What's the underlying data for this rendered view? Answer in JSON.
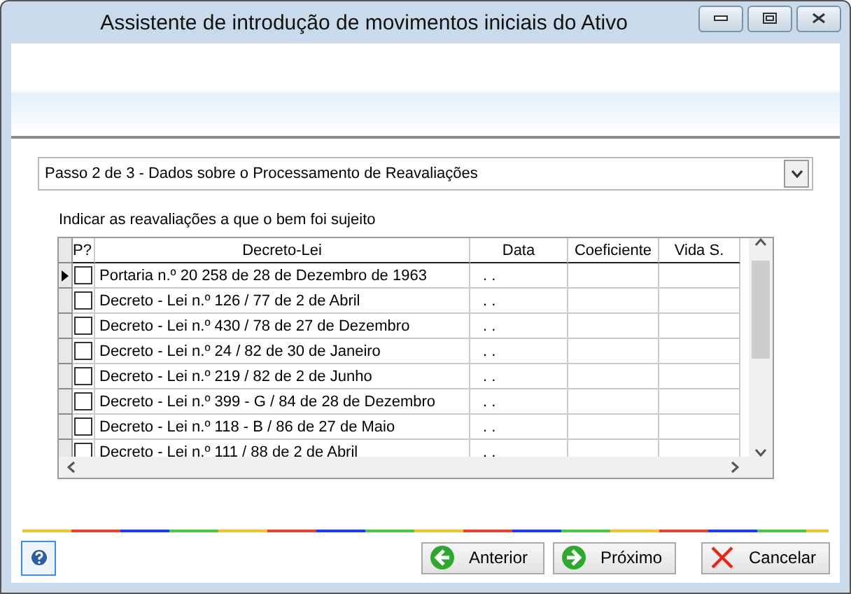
{
  "window": {
    "title": "Assistente de introdução de movimentos iniciais do Ativo"
  },
  "step": {
    "value": "Passo 2 de 3 - Dados sobre o Processamento de Reavaliações"
  },
  "instruction": "Indicar as reavaliações a que o bem foi sujeito",
  "table": {
    "columns": [
      "P?",
      "Decreto-Lei",
      "Data",
      "Coeficiente",
      "Vida S."
    ],
    "rows": [
      {
        "checked": false,
        "selected": true,
        "decree": "Portaria n.º 20 258 de 28 de Dezembro de 1963",
        "date": ". ."
      },
      {
        "checked": false,
        "selected": false,
        "decree": "Decreto - Lei n.º 126 / 77 de 2 de Abril",
        "date": ". ."
      },
      {
        "checked": false,
        "selected": false,
        "decree": "Decreto - Lei n.º 430 / 78 de 27 de Dezembro",
        "date": ". ."
      },
      {
        "checked": false,
        "selected": false,
        "decree": "Decreto - Lei n.º 24 / 82 de 30 de Janeiro",
        "date": ". ."
      },
      {
        "checked": false,
        "selected": false,
        "decree": "Decreto - Lei n.º 219 / 82 de 2 de Junho",
        "date": ". ."
      },
      {
        "checked": false,
        "selected": false,
        "decree": "Decreto - Lei n.º 399 - G / 84 de 28 de Dezembro",
        "date": ". ."
      },
      {
        "checked": false,
        "selected": false,
        "decree": "Decreto - Lei n.º 118 - B / 86 de 27 de Maio",
        "date": ". ."
      },
      {
        "checked": false,
        "selected": false,
        "decree": "Decreto - Lei n.º 111 / 88 de 2 de Abril",
        "date": ". ."
      }
    ]
  },
  "buttons": [
    {
      "kind": "back",
      "label": "Anterior"
    },
    {
      "kind": "next",
      "label": "Próximo"
    },
    {
      "kind": "cancel",
      "label": "Cancelar"
    }
  ]
}
